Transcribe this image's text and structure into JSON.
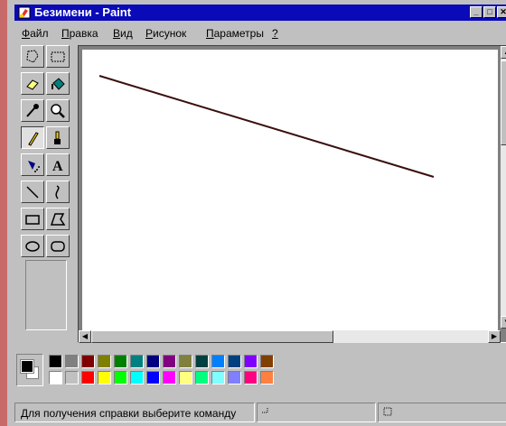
{
  "window": {
    "title": "Безимени - Paint",
    "icon": "paint-app-icon",
    "controls": [
      "minimize",
      "maximize",
      "close"
    ]
  },
  "menu": [
    {
      "label": "Файл",
      "hotkey": "Ф",
      "rest": "айл"
    },
    {
      "label": "Правка",
      "hotkey": "П",
      "rest": "равка"
    },
    {
      "label": "Вид",
      "hotkey": "В",
      "rest": "ид"
    },
    {
      "label": "Рисунок",
      "hotkey": "Р",
      "rest": "исунок"
    },
    {
      "label": "Параметры",
      "hotkey": "П",
      "rest": "араметры"
    },
    {
      "label": "?",
      "hotkey": "?",
      "rest": ""
    }
  ],
  "tools": [
    {
      "name": "free-form-select-icon",
      "selected": false
    },
    {
      "name": "select-icon",
      "selected": false
    },
    {
      "name": "eraser-icon",
      "selected": false
    },
    {
      "name": "fill-bucket-icon",
      "selected": false
    },
    {
      "name": "pick-color-icon",
      "selected": false
    },
    {
      "name": "magnifier-icon",
      "selected": false
    },
    {
      "name": "pencil-icon",
      "selected": true
    },
    {
      "name": "brush-icon",
      "selected": false
    },
    {
      "name": "airbrush-icon",
      "selected": false
    },
    {
      "name": "text-icon",
      "selected": false
    },
    {
      "name": "line-icon",
      "selected": false
    },
    {
      "name": "curve-icon",
      "selected": false
    },
    {
      "name": "rectangle-icon",
      "selected": false
    },
    {
      "name": "polygon-icon",
      "selected": false
    },
    {
      "name": "ellipse-icon",
      "selected": false
    },
    {
      "name": "rounded-rectangle-icon",
      "selected": false
    }
  ],
  "colors": {
    "foreground": "#000000",
    "background": "#ffffff",
    "line_color": "#3a0f0f",
    "palette": [
      "#000000",
      "#808080",
      "#800000",
      "#808000",
      "#008000",
      "#008080",
      "#000080",
      "#800080",
      "#808040",
      "#004040",
      "#0080ff",
      "#004080",
      "#8000ff",
      "#804000",
      "#ffffff",
      "#c0c0c0",
      "#ff0000",
      "#ffff00",
      "#00ff00",
      "#00ffff",
      "#0000ff",
      "#ff00ff",
      "#ffff80",
      "#00ff80",
      "#80ffff",
      "#8080ff",
      "#ff0080",
      "#ff8040"
    ]
  },
  "status": {
    "help_text": "Для получения справки выберите команду"
  }
}
